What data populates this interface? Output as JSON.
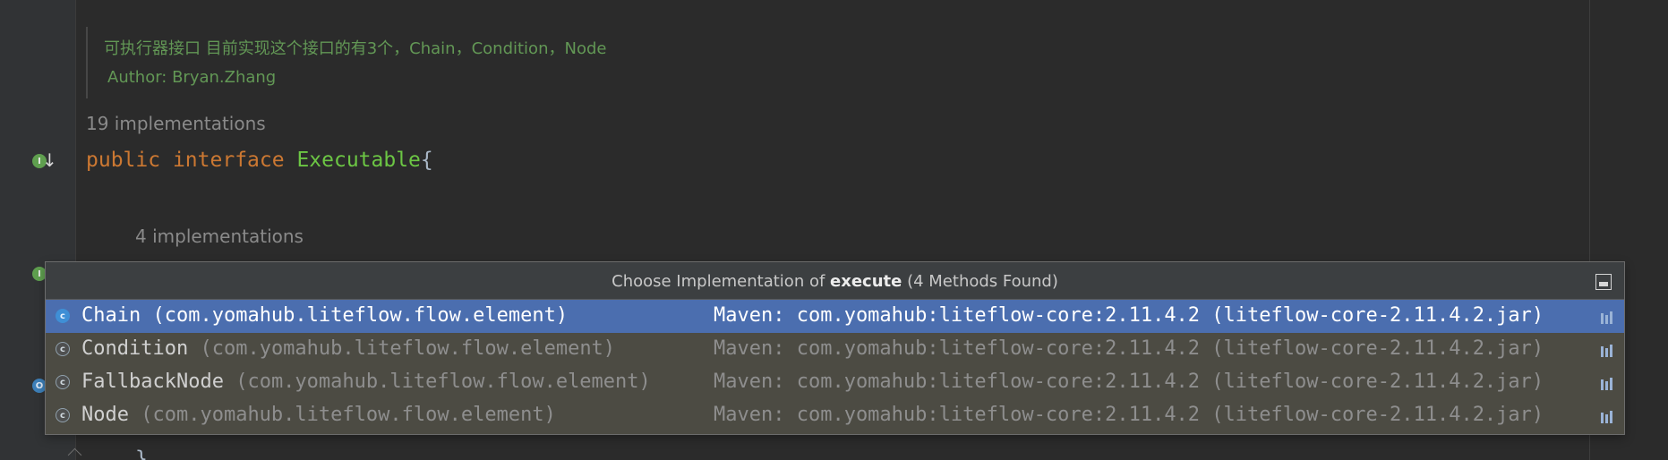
{
  "editor": {
    "doc": {
      "line1": "可执行器接口 目前实现这个接口的有3个，Chain，Condition，Node",
      "line2": "Author: Bryan.Zhang"
    },
    "hints": {
      "top": "19 implementations",
      "inner": "4 implementations"
    },
    "code": {
      "public_kw": "public",
      "interface_kw": "interface",
      "type_name": "Executable",
      "brace": "{",
      "tail": "}"
    },
    "gutter_icons": {
      "impl": "I",
      "down_arrow": "↓",
      "override": "O"
    }
  },
  "popup": {
    "title_prefix": "Choose Implementation of ",
    "title_method": "execute",
    "title_suffix": " (4 Methods Found)",
    "rows": [
      {
        "icon": "c",
        "name": "Chain",
        "package": "(com.yomahub.liteflow.flow.element)",
        "source": "Maven: com.yomahub:liteflow-core:2.11.4.2 (liteflow-core-2.11.4.2.jar)"
      },
      {
        "icon": "c",
        "name": "Condition",
        "package": "(com.yomahub.liteflow.flow.element)",
        "source": "Maven: com.yomahub:liteflow-core:2.11.4.2 (liteflow-core-2.11.4.2.jar)"
      },
      {
        "icon": "c",
        "name": "FallbackNode",
        "package": "(com.yomahub.liteflow.flow.element)",
        "source": "Maven: com.yomahub:liteflow-core:2.11.4.2 (liteflow-core-2.11.4.2.jar)"
      },
      {
        "icon": "c",
        "name": "Node",
        "package": "(com.yomahub.liteflow.flow.element)",
        "source": "Maven: com.yomahub:liteflow-core:2.11.4.2 (liteflow-core-2.11.4.2.jar)"
      }
    ]
  },
  "colors": {
    "selected_row": "#4b6eaf",
    "popup_background": "#4c4b43",
    "keyword": "#cc7832",
    "type_name": "#6cc644",
    "doc_comment": "#629755"
  }
}
